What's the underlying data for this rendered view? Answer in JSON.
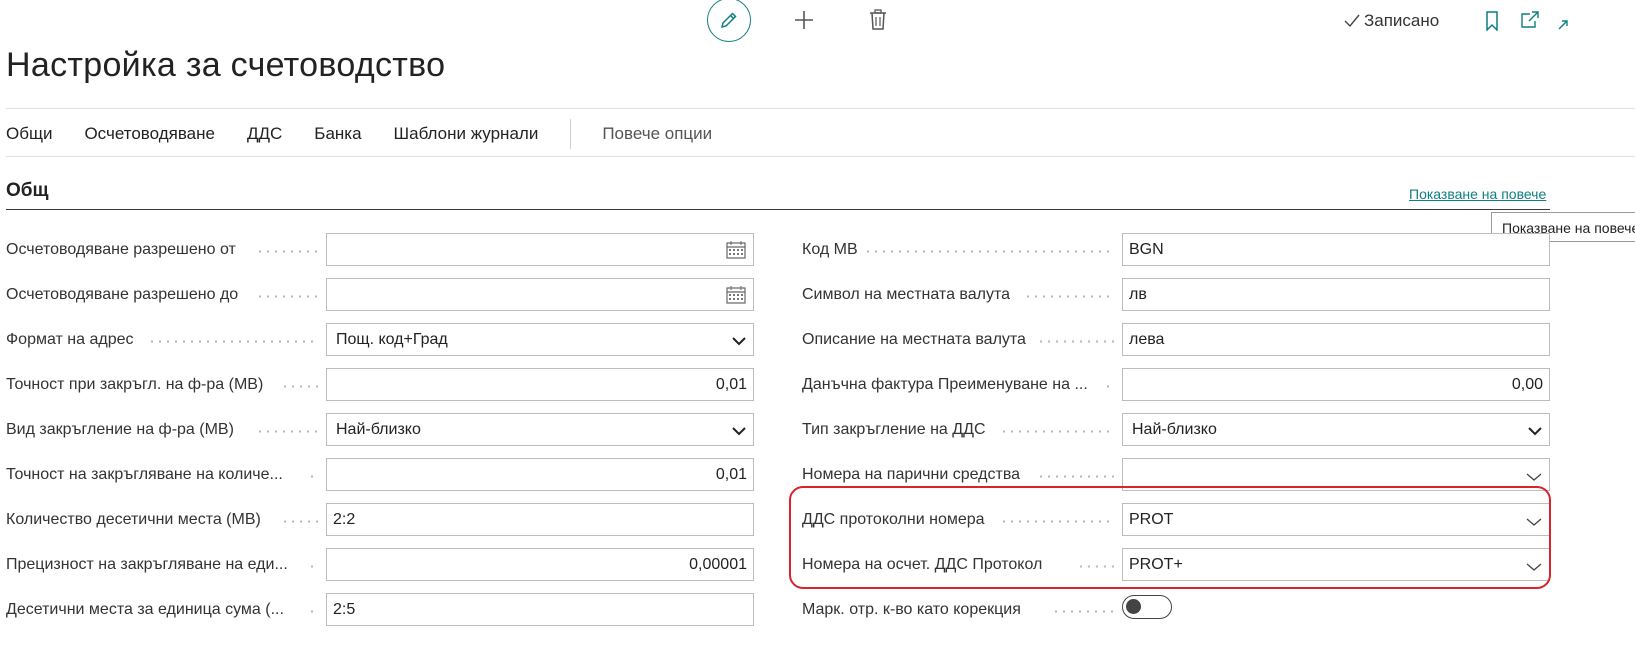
{
  "toolbar": {
    "edit_icon": "pencil-icon",
    "new_icon": "plus-icon",
    "delete_icon": "trash-icon",
    "saved_label": "Записано",
    "bookmark_icon": "bookmark-icon",
    "open_new_window_icon": "open-new-window-icon",
    "collapse_icon": "collapse-icon"
  },
  "page": {
    "title": "Настройка за счетоводство"
  },
  "nav": {
    "items": [
      "Общи",
      "Осчетоводяване",
      "ДДС",
      "Банка",
      "Шаблони журнали"
    ],
    "more": "Повече опции"
  },
  "section": {
    "title": "Общ",
    "show_more": "Показване на повече",
    "tooltip": "Показване на повече"
  },
  "left_fields": [
    {
      "label": "Осчетоводяване разрешено от",
      "value": "",
      "kind": "date"
    },
    {
      "label": "Осчетоводяване разрешено до",
      "value": "",
      "kind": "date"
    },
    {
      "label": "Формат на адрес",
      "value": "Пощ. код+Град",
      "kind": "select"
    },
    {
      "label": "Точност при закръгл. на ф-ра (МВ)",
      "value": "0,01",
      "kind": "number"
    },
    {
      "label": "Вид закръгление на ф-ра (МВ)",
      "value": "Най-близко",
      "kind": "select"
    },
    {
      "label": "Точност на закръгляване на количе...",
      "value": "0,01",
      "kind": "number"
    },
    {
      "label": "Количество десетични места (МВ)",
      "value": "2:2",
      "kind": "text"
    },
    {
      "label": "Прецизност на закръгляване на еди...",
      "value": "0,00001",
      "kind": "number"
    },
    {
      "label": "Десетични места за единица сума (...",
      "value": "2:5",
      "kind": "text"
    }
  ],
  "right_fields": [
    {
      "label": "Код МВ",
      "value": "BGN",
      "kind": "text"
    },
    {
      "label": "Символ на местната валута",
      "value": "лв",
      "kind": "text"
    },
    {
      "label": "Описание на местната валута",
      "value": "лева",
      "kind": "text"
    },
    {
      "label": "Данъчна фактура Преименуване на ...",
      "value": "0,00",
      "kind": "number"
    },
    {
      "label": "Тип закръгление на ДДС",
      "value": "Най-близко",
      "kind": "select"
    },
    {
      "label": "Номера на парични средства",
      "value": "",
      "kind": "lookup"
    },
    {
      "label": "ДДС протоколни номера",
      "value": "PROT",
      "kind": "lookup"
    },
    {
      "label": "Номера на осчет. ДДС Протокол",
      "value": "PROT+",
      "kind": "lookup"
    },
    {
      "label": "Марк. отр. к-во като корекция",
      "value": false,
      "kind": "toggle"
    }
  ],
  "colors": {
    "accent": "#0e7f82",
    "highlight": "#d9232d"
  }
}
